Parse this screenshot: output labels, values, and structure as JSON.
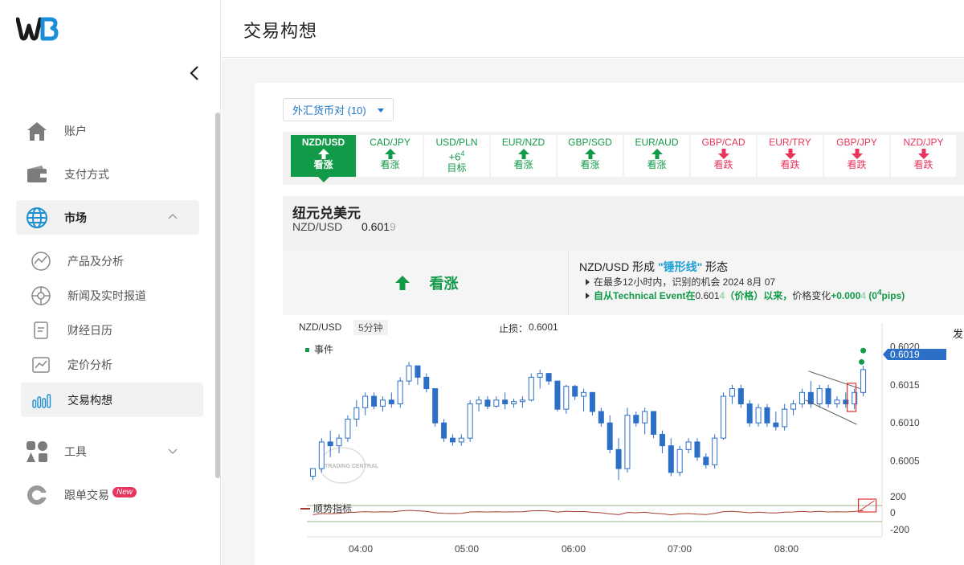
{
  "app": {
    "logo_text": "WB"
  },
  "sidebar": {
    "items": [
      {
        "label": "账户",
        "icon": "home-icon"
      },
      {
        "label": "支付方式",
        "icon": "wallet-icon"
      },
      {
        "label": "市场",
        "icon": "globe-icon"
      },
      {
        "label": "工具",
        "icon": "tools-icon"
      },
      {
        "label": "跟单交易",
        "icon": "copy-trade-icon",
        "badge": "New"
      }
    ],
    "market_subitems": [
      {
        "label": "产品及分析",
        "icon": "product-analysis-icon"
      },
      {
        "label": "新闻及实时报道",
        "icon": "news-icon"
      },
      {
        "label": "财经日历",
        "icon": "calendar-icon"
      },
      {
        "label": "定价分析",
        "icon": "pricing-chart-icon"
      },
      {
        "label": "交易构想",
        "icon": "trade-ideas-icon"
      }
    ]
  },
  "header": {
    "title": "交易构想"
  },
  "filter": {
    "label": "外汇货币对 (10)"
  },
  "pairs": [
    {
      "name": "NZD/USD",
      "signal": "看涨",
      "dir": "up"
    },
    {
      "name": "CAD/JPY",
      "signal": "看涨",
      "dir": "up"
    },
    {
      "name": "USD/PLN",
      "signal": "目标",
      "dir": "target",
      "value": "+6",
      "value_sup": "4"
    },
    {
      "name": "EUR/NZD",
      "signal": "看涨",
      "dir": "up"
    },
    {
      "name": "GBP/SGD",
      "signal": "看涨",
      "dir": "up"
    },
    {
      "name": "EUR/AUD",
      "signal": "看涨",
      "dir": "up"
    },
    {
      "name": "GBP/CAD",
      "signal": "看跌",
      "dir": "down"
    },
    {
      "name": "EUR/TRY",
      "signal": "看跌",
      "dir": "down"
    },
    {
      "name": "GBP/JPY",
      "signal": "看跌",
      "dir": "down"
    },
    {
      "name": "NZD/JPY",
      "signal": "看跌",
      "dir": "down"
    }
  ],
  "instrument": {
    "name": "纽元兑美元",
    "symbol": "NZD/USD",
    "price_main": "0.601",
    "price_dim": "9"
  },
  "signal": {
    "label": "看涨"
  },
  "pattern": {
    "title_prefix": "NZD/USD 形成 ",
    "title_highlight": "\"锤形线\"",
    "title_suffix": " 形态",
    "line1": "在最多12小时内，识别的机会 2024 8月 07",
    "line2_a": "自从Technical Event在",
    "line2_b": "0.601",
    "line2_b_dim": "4",
    "line2_c": "（价格）以来，",
    "line2_d": "价格变化",
    "line2_e": "+0.000",
    "line2_e_dim": "4",
    "line2_f": " (0",
    "line2_f_sup": "4",
    "line2_g": "pips)"
  },
  "chart": {
    "symbol": "NZD/USD",
    "timeframe": "5分钟",
    "stop_label": "止损：",
    "stop_value": "0.6001",
    "event_legend": "事件",
    "indicator_label": "顺势指标",
    "watermark": "TRADING CENTRAL",
    "current_price": "0.6019",
    "right_fragment": "发"
  },
  "chart_data": {
    "type": "candlestick",
    "y_ticks": [
      "0.6020",
      "0.6015",
      "0.6010",
      "0.6005"
    ],
    "ylim": [
      0.6002,
      0.6021
    ],
    "x_ticks": [
      "04:00",
      "05:00",
      "06:00",
      "07:00",
      "08:00"
    ],
    "indicator_ticks": [
      "200",
      "0",
      "-200"
    ],
    "candles": [
      {
        "o": 0.6003,
        "h": 0.6004,
        "l": 0.60025,
        "c": 0.6004
      },
      {
        "o": 0.6004,
        "h": 0.6008,
        "l": 0.60035,
        "c": 0.60075
      },
      {
        "o": 0.60075,
        "h": 0.6009,
        "l": 0.60055,
        "c": 0.6007
      },
      {
        "o": 0.6007,
        "h": 0.60085,
        "l": 0.6006,
        "c": 0.6008
      },
      {
        "o": 0.6008,
        "h": 0.6011,
        "l": 0.60075,
        "c": 0.60105
      },
      {
        "o": 0.60105,
        "h": 0.6013,
        "l": 0.60095,
        "c": 0.6012
      },
      {
        "o": 0.6012,
        "h": 0.6014,
        "l": 0.6011,
        "c": 0.60135
      },
      {
        "o": 0.60135,
        "h": 0.6014,
        "l": 0.60118,
        "c": 0.60122
      },
      {
        "o": 0.60122,
        "h": 0.60135,
        "l": 0.60115,
        "c": 0.6013
      },
      {
        "o": 0.6013,
        "h": 0.6014,
        "l": 0.6012,
        "c": 0.60125
      },
      {
        "o": 0.60125,
        "h": 0.6016,
        "l": 0.6012,
        "c": 0.60155
      },
      {
        "o": 0.60155,
        "h": 0.6018,
        "l": 0.6015,
        "c": 0.60175
      },
      {
        "o": 0.60175,
        "h": 0.60165,
        "l": 0.6015,
        "c": 0.6016
      },
      {
        "o": 0.6016,
        "h": 0.60165,
        "l": 0.6014,
        "c": 0.60145
      },
      {
        "o": 0.60145,
        "h": 0.60145,
        "l": 0.60095,
        "c": 0.601
      },
      {
        "o": 0.601,
        "h": 0.60105,
        "l": 0.60075,
        "c": 0.6008
      },
      {
        "o": 0.6008,
        "h": 0.60085,
        "l": 0.6007,
        "c": 0.60075
      },
      {
        "o": 0.60075,
        "h": 0.60085,
        "l": 0.6007,
        "c": 0.6008
      },
      {
        "o": 0.6008,
        "h": 0.6013,
        "l": 0.60075,
        "c": 0.60125
      },
      {
        "o": 0.60125,
        "h": 0.60135,
        "l": 0.60115,
        "c": 0.6013
      },
      {
        "o": 0.6013,
        "h": 0.60135,
        "l": 0.60118,
        "c": 0.60122
      },
      {
        "o": 0.60122,
        "h": 0.60135,
        "l": 0.6012,
        "c": 0.6013
      },
      {
        "o": 0.6013,
        "h": 0.6014,
        "l": 0.60118,
        "c": 0.60125
      },
      {
        "o": 0.60125,
        "h": 0.60132,
        "l": 0.6012,
        "c": 0.60128
      },
      {
        "o": 0.60128,
        "h": 0.60135,
        "l": 0.6012,
        "c": 0.6013
      },
      {
        "o": 0.6013,
        "h": 0.60165,
        "l": 0.60128,
        "c": 0.6016
      },
      {
        "o": 0.6016,
        "h": 0.6017,
        "l": 0.60145,
        "c": 0.60165
      },
      {
        "o": 0.60165,
        "h": 0.60165,
        "l": 0.6015,
        "c": 0.60155
      },
      {
        "o": 0.60155,
        "h": 0.60155,
        "l": 0.60115,
        "c": 0.60118
      },
      {
        "o": 0.60118,
        "h": 0.6015,
        "l": 0.60112,
        "c": 0.60148
      },
      {
        "o": 0.60148,
        "h": 0.6015,
        "l": 0.6013,
        "c": 0.60135
      },
      {
        "o": 0.60135,
        "h": 0.60145,
        "l": 0.60115,
        "c": 0.6014
      },
      {
        "o": 0.6014,
        "h": 0.6014,
        "l": 0.6011,
        "c": 0.60115
      },
      {
        "o": 0.60115,
        "h": 0.6012,
        "l": 0.60095,
        "c": 0.601
      },
      {
        "o": 0.601,
        "h": 0.6011,
        "l": 0.6006,
        "c": 0.60065
      },
      {
        "o": 0.60065,
        "h": 0.6008,
        "l": 0.60025,
        "c": 0.6004
      },
      {
        "o": 0.6004,
        "h": 0.6012,
        "l": 0.60035,
        "c": 0.6011
      },
      {
        "o": 0.6011,
        "h": 0.60115,
        "l": 0.60095,
        "c": 0.601
      },
      {
        "o": 0.601,
        "h": 0.6012,
        "l": 0.60085,
        "c": 0.60115
      },
      {
        "o": 0.60115,
        "h": 0.60115,
        "l": 0.6008,
        "c": 0.60085
      },
      {
        "o": 0.60085,
        "h": 0.6009,
        "l": 0.6006,
        "c": 0.6007
      },
      {
        "o": 0.6007,
        "h": 0.6008,
        "l": 0.6003,
        "c": 0.60035
      },
      {
        "o": 0.60035,
        "h": 0.6007,
        "l": 0.6003,
        "c": 0.60065
      },
      {
        "o": 0.60065,
        "h": 0.6008,
        "l": 0.6006,
        "c": 0.60075
      },
      {
        "o": 0.60075,
        "h": 0.6008,
        "l": 0.6005,
        "c": 0.60055
      },
      {
        "o": 0.60055,
        "h": 0.6006,
        "l": 0.6004,
        "c": 0.60045
      },
      {
        "o": 0.60045,
        "h": 0.60085,
        "l": 0.6004,
        "c": 0.6008
      },
      {
        "o": 0.6008,
        "h": 0.6014,
        "l": 0.60078,
        "c": 0.60135
      },
      {
        "o": 0.60135,
        "h": 0.6015,
        "l": 0.60125,
        "c": 0.60145
      },
      {
        "o": 0.60145,
        "h": 0.6015,
        "l": 0.6012,
        "c": 0.60125
      },
      {
        "o": 0.60125,
        "h": 0.6013,
        "l": 0.60095,
        "c": 0.601
      },
      {
        "o": 0.601,
        "h": 0.60125,
        "l": 0.60095,
        "c": 0.6012
      },
      {
        "o": 0.6012,
        "h": 0.60125,
        "l": 0.60095,
        "c": 0.601
      },
      {
        "o": 0.601,
        "h": 0.60115,
        "l": 0.6009,
        "c": 0.60095
      },
      {
        "o": 0.60095,
        "h": 0.60125,
        "l": 0.6009,
        "c": 0.60118
      },
      {
        "o": 0.60118,
        "h": 0.6013,
        "l": 0.6011,
        "c": 0.60125
      },
      {
        "o": 0.60125,
        "h": 0.60145,
        "l": 0.6012,
        "c": 0.6014
      },
      {
        "o": 0.6014,
        "h": 0.60155,
        "l": 0.6012,
        "c": 0.60125
      },
      {
        "o": 0.60125,
        "h": 0.6015,
        "l": 0.6012,
        "c": 0.60145
      },
      {
        "o": 0.60145,
        "h": 0.6015,
        "l": 0.6012,
        "c": 0.60125
      },
      {
        "o": 0.60125,
        "h": 0.60135,
        "l": 0.6012,
        "c": 0.6013
      },
      {
        "o": 0.6013,
        "h": 0.6014,
        "l": 0.6012,
        "c": 0.60125
      },
      {
        "o": 0.60125,
        "h": 0.60145,
        "l": 0.60118,
        "c": 0.6014
      },
      {
        "o": 0.6014,
        "h": 0.60175,
        "l": 0.60135,
        "c": 0.6017
      }
    ],
    "events": [
      0.60195,
      0.6018
    ],
    "colors": {
      "up": "#ffffff",
      "down": "#2c6fc7",
      "wick": "#2c6fc7",
      "price_tag": "#2c6fc7",
      "indicator": "#a33d2d"
    }
  },
  "colors": {
    "bull": "#119a47",
    "bear": "#e8355d",
    "link": "#1e76c7",
    "highlight": "#21a0d8"
  }
}
